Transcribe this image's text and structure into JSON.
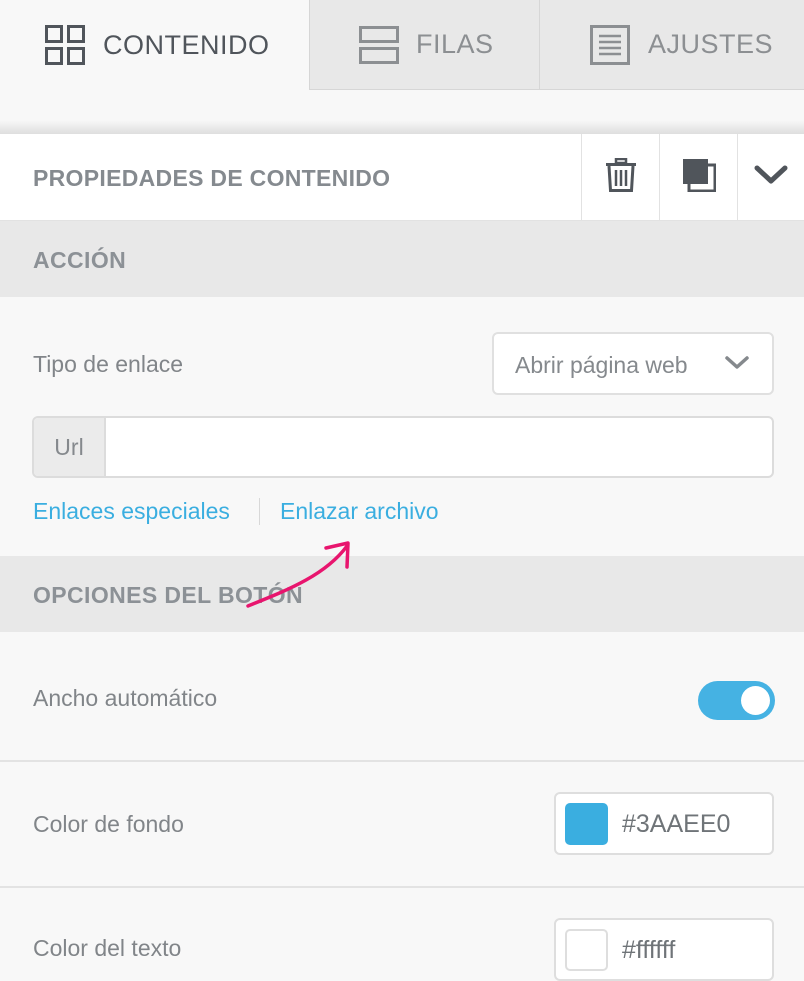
{
  "tabs": [
    {
      "label": "CONTENIDO",
      "icon": "grid-icon",
      "active": true
    },
    {
      "label": "FILAS",
      "icon": "rows-icon",
      "active": false
    },
    {
      "label": "AJUSTES",
      "icon": "settings-doc-icon",
      "active": false
    }
  ],
  "properties": {
    "title": "PROPIEDADES DE CONTENIDO",
    "actions": [
      "trash-icon",
      "duplicate-icon",
      "chevron-down-icon"
    ]
  },
  "action_section": {
    "title": "ACCIÓN",
    "link_type_label": "Tipo de enlace",
    "link_type_value": "Abrir página web",
    "url_addon": "Url",
    "url_value": "",
    "special_links": "Enlaces especiales",
    "link_file": "Enlazar archivo"
  },
  "button_options": {
    "title": "OPCIONES DEL BOTÓN",
    "auto_width_label": "Ancho automático",
    "auto_width_on": true,
    "bg_color_label": "Color de fondo",
    "bg_color_value": "#3AAEE0",
    "text_color_label": "Color del texto",
    "text_color_value": "#ffffff"
  },
  "colors": {
    "accent": "#3aaee0",
    "annotation_arrow": "#e8156e"
  }
}
